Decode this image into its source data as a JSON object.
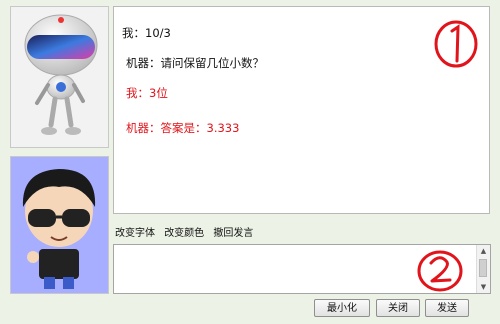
{
  "chat": {
    "messages": [
      {
        "speaker": "我",
        "text": "我：10/3",
        "color": "#111111"
      },
      {
        "speaker": "机器",
        "text": "机器：请问保留几位小数？",
        "color": "#111111"
      },
      {
        "speaker": "我",
        "text": "我：3位",
        "color": "#e0141a"
      },
      {
        "speaker": "机器",
        "text": "机器：答案是：3.333",
        "color": "#e0141a"
      }
    ]
  },
  "toolbar": {
    "change_font": "改变字体",
    "change_color": "改变颜色",
    "undo_message": "撤回发言"
  },
  "input": {
    "value": ""
  },
  "buttons": {
    "minimize": "最小化",
    "close": "关闭",
    "send": "发送"
  },
  "colors": {
    "accent_red": "#e0141a",
    "user_avatar_bg": "#a7aeff"
  }
}
